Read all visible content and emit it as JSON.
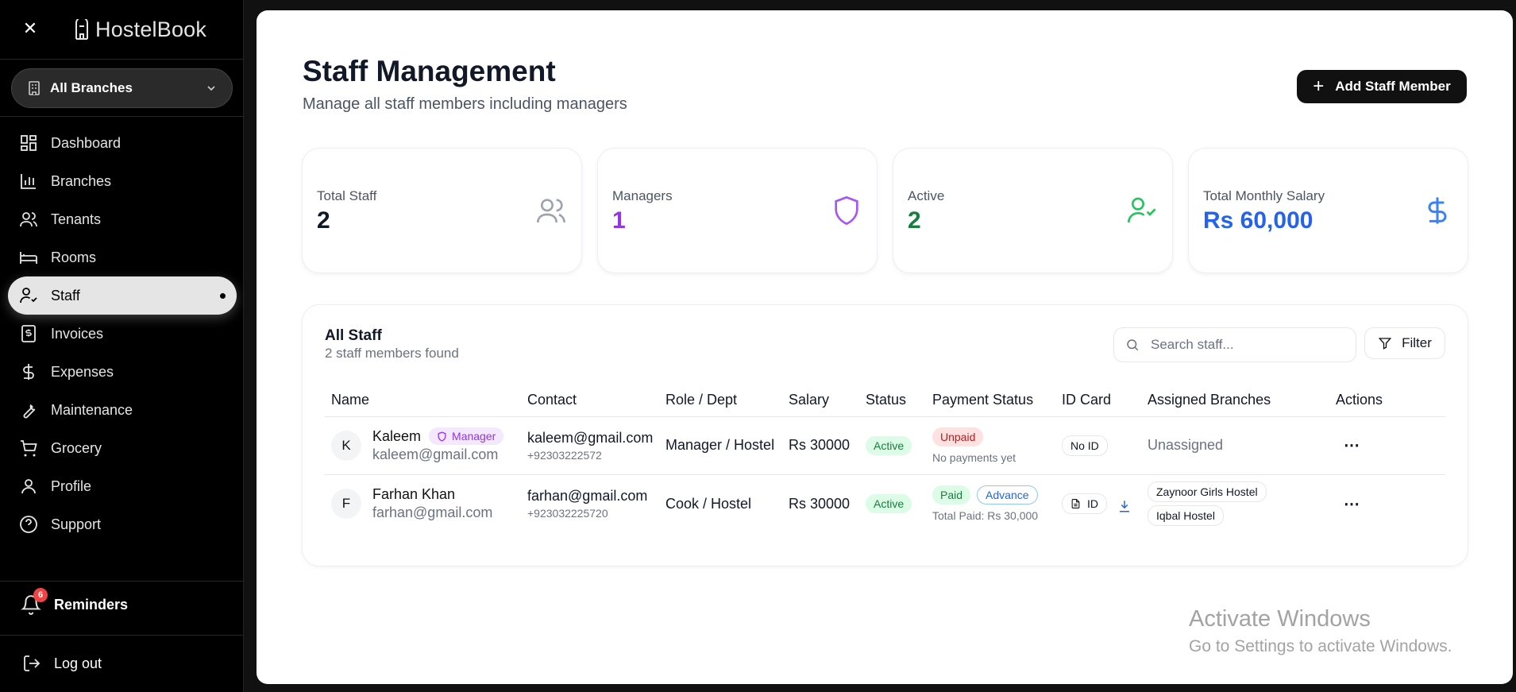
{
  "app": {
    "logo_text": "HostelBook"
  },
  "branch_select": {
    "label": "All Branches"
  },
  "sidebar": {
    "items": [
      {
        "label": "Dashboard",
        "icon": "dashboard-icon"
      },
      {
        "label": "Branches",
        "icon": "bar-chart-icon"
      },
      {
        "label": "Tenants",
        "icon": "users-icon"
      },
      {
        "label": "Rooms",
        "icon": "bed-icon"
      },
      {
        "label": "Staff",
        "icon": "user-check-icon",
        "active": true
      },
      {
        "label": "Invoices",
        "icon": "receipt-icon"
      },
      {
        "label": "Expenses",
        "icon": "dollar-icon"
      },
      {
        "label": "Maintenance",
        "icon": "wrench-icon"
      },
      {
        "label": "Grocery",
        "icon": "cart-icon"
      },
      {
        "label": "Profile",
        "icon": "user-icon"
      },
      {
        "label": "Support",
        "icon": "help-icon"
      }
    ],
    "reminders": {
      "label": "Reminders",
      "count": "6"
    },
    "logout": "Log out"
  },
  "header": {
    "title": "Staff Management",
    "subtitle": "Manage all staff members including managers",
    "add_button": "Add Staff Member"
  },
  "stats": [
    {
      "label": "Total Staff",
      "value": "2",
      "color": "#111827",
      "icon": "users-icon"
    },
    {
      "label": "Managers",
      "value": "1",
      "color": "#9333ea",
      "icon": "shield-icon"
    },
    {
      "label": "Active",
      "value": "2",
      "color": "#15803d",
      "icon": "user-check-icon"
    },
    {
      "label": "Total Monthly Salary",
      "value": "Rs 60,000",
      "color": "#2563eb",
      "icon": "dollar-icon"
    }
  ],
  "staff_list": {
    "title": "All Staff",
    "count_text": "2 staff members found",
    "search_placeholder": "Search staff...",
    "filter_label": "Filter",
    "columns": [
      "Name",
      "Contact",
      "Role / Dept",
      "Salary",
      "Status",
      "Payment Status",
      "ID Card",
      "Assigned Branches",
      "Actions"
    ],
    "rows": [
      {
        "initial": "K",
        "name": "Kaleem",
        "badge": "Manager",
        "email": "kaleem@gmail.com",
        "contact_email": "kaleem@gmail.com",
        "phone": "+92303222572",
        "role": "Manager / Hostel",
        "salary": "Rs 30000",
        "status": "Active",
        "payment": "Unpaid",
        "payment_note": "No payments yet",
        "id_card": "No ID",
        "branches_text": "Unassigned"
      },
      {
        "initial": "F",
        "name": "Farhan Khan",
        "email": "farhan@gmail.com",
        "contact_email": "farhan@gmail.com",
        "phone": "+923032225720",
        "role": "Cook / Hostel",
        "salary": "Rs 30000",
        "status": "Active",
        "payment": "Paid",
        "payment_extra": "Advance",
        "payment_note": "Total Paid: Rs 30,000",
        "id_card": "ID",
        "branches": [
          "Zaynoor Girls Hostel",
          "Iqbal Hostel"
        ]
      }
    ]
  },
  "watermark": {
    "line1": "Activate Windows",
    "line2": "Go to Settings to activate Windows."
  }
}
